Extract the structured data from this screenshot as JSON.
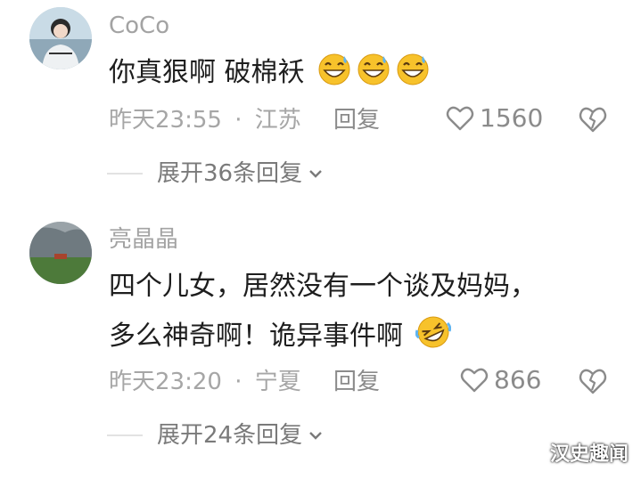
{
  "comments": [
    {
      "username": "CoCo",
      "content_line1": "你真狠啊  破棉袄",
      "emoji_icons": [
        "sweat-smile-icon",
        "sweat-smile-icon",
        "sweat-smile-icon"
      ],
      "time": "昨天23:55",
      "separator": "·",
      "location": "江苏",
      "reply_label": "回复",
      "likes": "1560",
      "expand_label": "展开36条回复"
    },
    {
      "username": "亮晶晶",
      "content_line1": "四个儿女，居然没有一个谈及妈妈，",
      "content_line2": "多么神奇啊！诡异事件啊",
      "emoji_icons": [
        "rofl-icon"
      ],
      "time": "昨天23:20",
      "separator": "·",
      "location": "宁夏",
      "reply_label": "回复",
      "likes": "866",
      "expand_label": "展开24条回复"
    }
  ],
  "watermark": "汉史趣闻",
  "colors": {
    "meta": "#a6a6a6",
    "text": "#1e1e1e",
    "emoji": "#f7c22b"
  }
}
